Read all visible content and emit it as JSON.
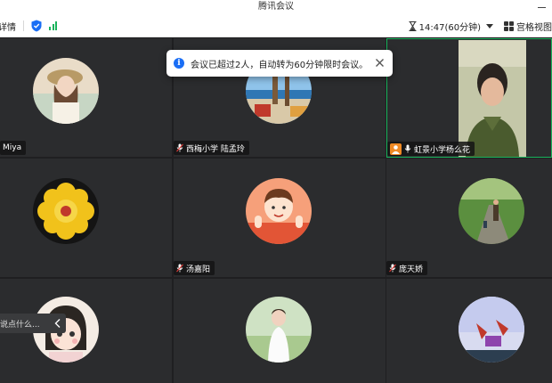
{
  "window": {
    "title": "腾讯会议"
  },
  "toolbar": {
    "details_label": "详情",
    "timer": "14:47(60分钟)",
    "view_label": "宫格视图"
  },
  "notice": {
    "text": "会议已超过2人，自动转为60分钟限时会议。"
  },
  "participants": [
    {
      "name": "Miya"
    },
    {
      "name": "西梅小学 陆孟玲"
    },
    {
      "name": "虹景小学杨么花"
    },
    {
      "name": ""
    },
    {
      "name": "汤嘉阳"
    },
    {
      "name": "庞天娇"
    },
    {
      "name": ""
    },
    {
      "name": ""
    },
    {
      "name": ""
    }
  ],
  "chat_preview": {
    "text": "说点什么..."
  },
  "colors": {
    "accent": "#19b35c",
    "info": "#1a6ef5",
    "host_badge": "#f08a24"
  }
}
